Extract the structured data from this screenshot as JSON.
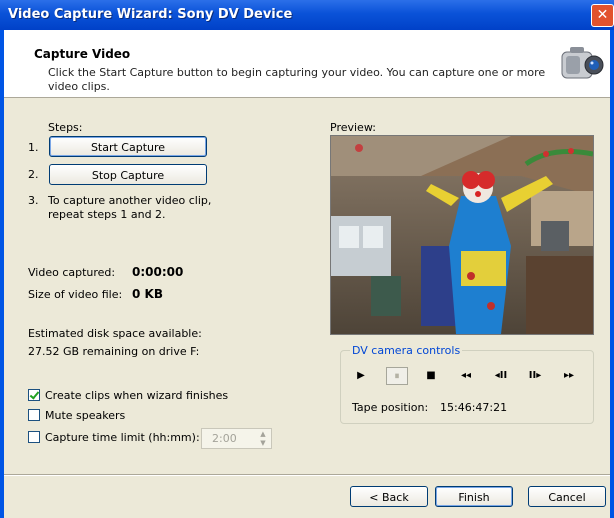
{
  "window": {
    "title": "Video Capture Wizard: Sony DV Device",
    "close_glyph": "✕"
  },
  "header": {
    "title": "Capture Video",
    "description": "Click the Start Capture button to begin capturing your video. You can capture one or more video clips."
  },
  "steps": {
    "heading": "Steps:",
    "step1_num": "1.",
    "step2_num": "2.",
    "step3_num": "3.",
    "start_label": "Start Capture",
    "stop_label": "Stop Capture",
    "step3_line1": "To capture another video clip,",
    "step3_line2": "repeat steps 1 and 2."
  },
  "stats": {
    "captured_label": "Video captured:",
    "captured_value": "0:00:00",
    "size_label": "Size of video file:",
    "size_value": "0 KB",
    "disk_label": "Estimated disk space available:",
    "disk_value": "27.52 GB remaining on drive F:"
  },
  "options": {
    "create_clips_label": "Create clips when wizard finishes",
    "create_clips_checked": true,
    "mute_label": "Mute speakers",
    "mute_checked": false,
    "time_limit_label": "Capture time limit (hh:mm):",
    "time_limit_checked": false,
    "time_limit_value": "2:00"
  },
  "preview": {
    "label": "Preview:"
  },
  "dv_controls": {
    "label": "DV camera controls",
    "play": "▶",
    "pause": "⏸",
    "stop": "■",
    "rewind": "◂◂",
    "step_back": "◂II",
    "step_forward": "II▸",
    "fast_forward": "▸▸",
    "tape_position_label": "Tape position:",
    "tape_position_value": "15:46:47:21"
  },
  "footer": {
    "back_label": "< Back",
    "finish_label": "Finish",
    "cancel_label": "Cancel"
  },
  "colors": {
    "titlebar": "#0a52d8",
    "accent": "#0046d5",
    "face": "#ece9d8"
  }
}
